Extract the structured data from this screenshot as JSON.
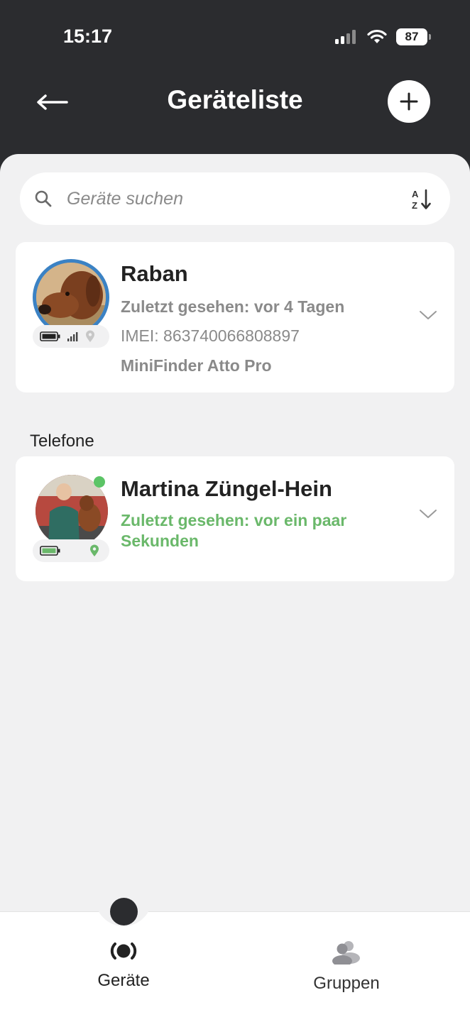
{
  "status_bar": {
    "time": "15:17",
    "battery": "87"
  },
  "header": {
    "title": "Geräteliste"
  },
  "search": {
    "placeholder": "Geräte suchen"
  },
  "devices": [
    {
      "name": "Raban",
      "last_seen": "Zuletzt gesehen: vor 4 Tagen",
      "imei": "IMEI: 863740066808897",
      "model": "MiniFinder Atto Pro"
    }
  ],
  "phones_section": {
    "label": "Telefone"
  },
  "phones": [
    {
      "name": "Martina Züngel-Hein",
      "last_seen": "Zuletzt gesehen: vor ein paar Sekunden"
    }
  ],
  "tabs": [
    {
      "label": "Geräte",
      "active": true
    },
    {
      "label": "Gruppen",
      "active": false
    }
  ],
  "colors": {
    "header_bg": "#2b2c2f",
    "accent_green": "#6ab86a",
    "avatar_ring": "#3b82c4",
    "online": "#5cc466"
  }
}
